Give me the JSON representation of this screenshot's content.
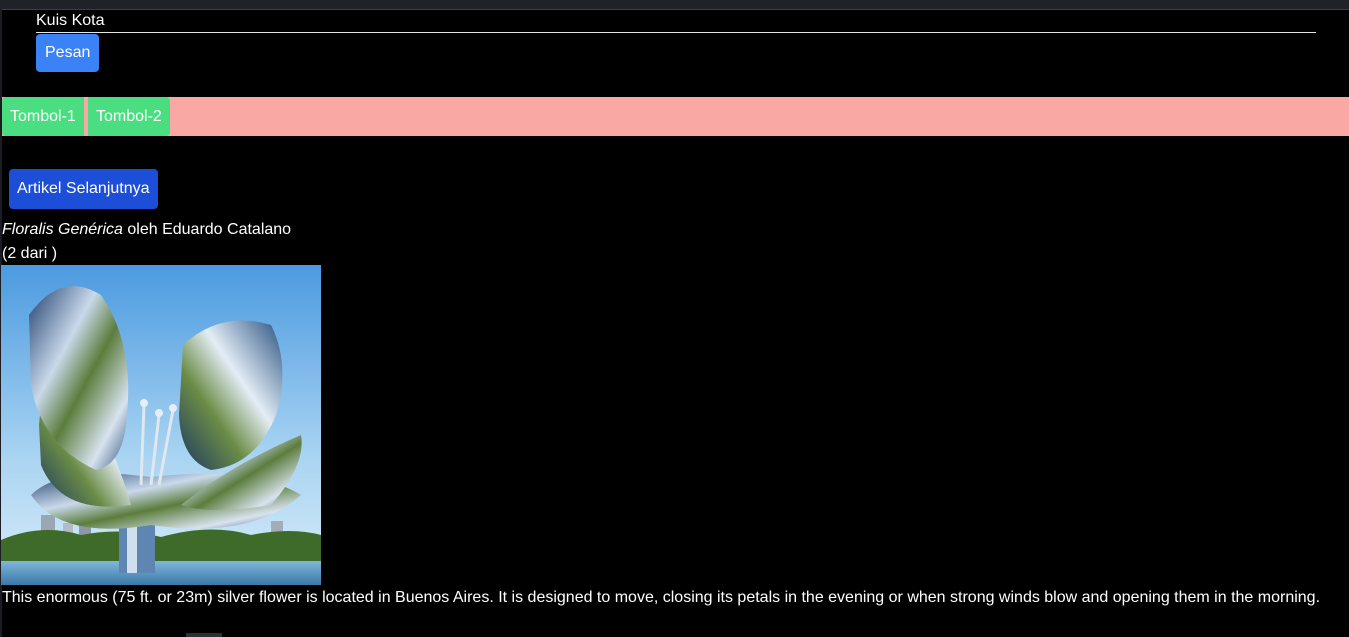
{
  "quiz": {
    "title": "Kuis Kota",
    "message_button": "Pesan"
  },
  "toolbar": {
    "button_1": "Tombol-1",
    "button_2": "Tombol-2"
  },
  "article": {
    "next_button": "Artikel Selanjutnya",
    "artwork_title": "Floralis Genérica",
    "artist_text": " oleh Eduardo Catalano",
    "counter": "(2 dari )",
    "description": "This enormous (75 ft. or 23m) silver flower is located in Buenos Aires. It is designed to move, closing its petals in the evening or when strong winds blow and opening them in the morning."
  },
  "colors": {
    "background": "#000000",
    "pink_bar": "#f9a8a4",
    "green_button": "#4ade80",
    "blue_button": "#3b82f6",
    "dark_blue_button": "#1d4ed8"
  }
}
